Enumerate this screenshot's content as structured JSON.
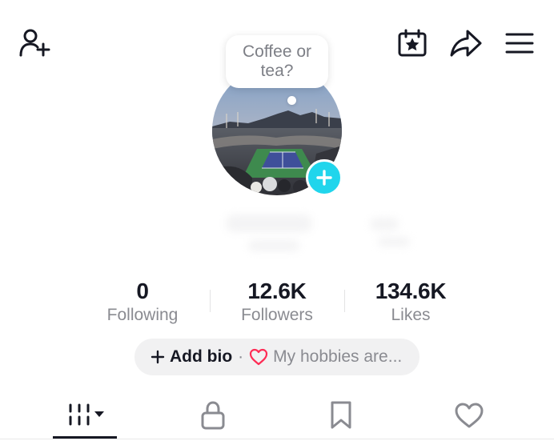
{
  "header": {
    "add_friend_icon": "person-plus-icon",
    "calendar_icon": "calendar-star-icon",
    "share_icon": "share-arrow-icon",
    "menu_icon": "hamburger-menu-icon"
  },
  "bubble": {
    "line1": "Coffee or",
    "line2": "tea?"
  },
  "avatar": {
    "add_icon": "plus-icon",
    "accent": "#20d5ec"
  },
  "stats": [
    {
      "value": "0",
      "label": "Following"
    },
    {
      "value": "12.6K",
      "label": "Followers"
    },
    {
      "value": "134.6K",
      "label": "Likes"
    }
  ],
  "bio": {
    "add_label": "Add bio",
    "separator": "·",
    "hint": "My hobbies are...",
    "heart_color": "#fe2c55"
  },
  "tabs": [
    {
      "icon": "videos-grid-icon",
      "active": true
    },
    {
      "icon": "lock-icon",
      "active": false
    },
    {
      "icon": "bookmark-icon",
      "active": false
    },
    {
      "icon": "heart-icon",
      "active": false
    }
  ]
}
